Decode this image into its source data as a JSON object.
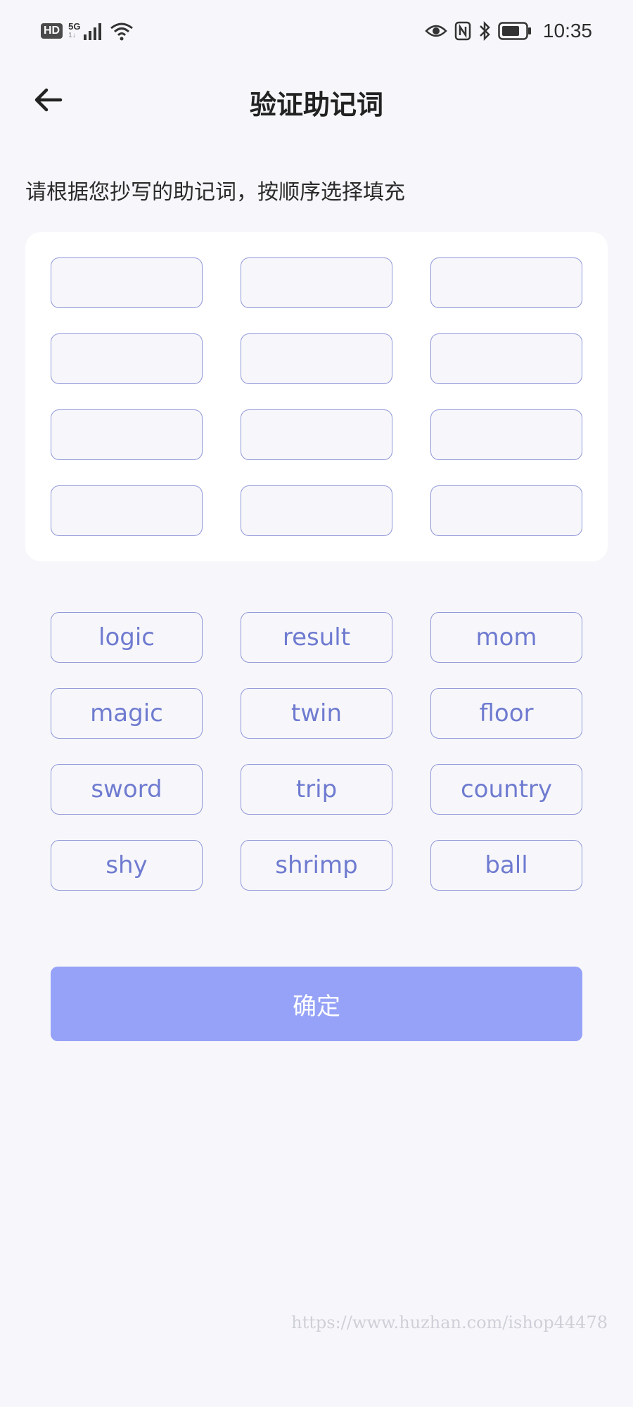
{
  "status_bar": {
    "hd": "HD",
    "network": "5G",
    "network_sub": "1↓",
    "time": "10:35"
  },
  "header": {
    "title": "验证助记词"
  },
  "instruction": "请根据您抄写的助记词，按顺序选择填充",
  "slots_count": 12,
  "words": [
    "logic",
    "result",
    "mom",
    "magic",
    "twin",
    "floor",
    "sword",
    "trip",
    "country",
    "shy",
    "shrimp",
    "ball"
  ],
  "confirm_label": "确定",
  "watermark": "https://www.huzhan.com/ishop44478",
  "colors": {
    "accent": "#96a2f7",
    "border": "#8f96d8",
    "word_text": "#6f7bd0",
    "background": "#f7f7fb"
  }
}
